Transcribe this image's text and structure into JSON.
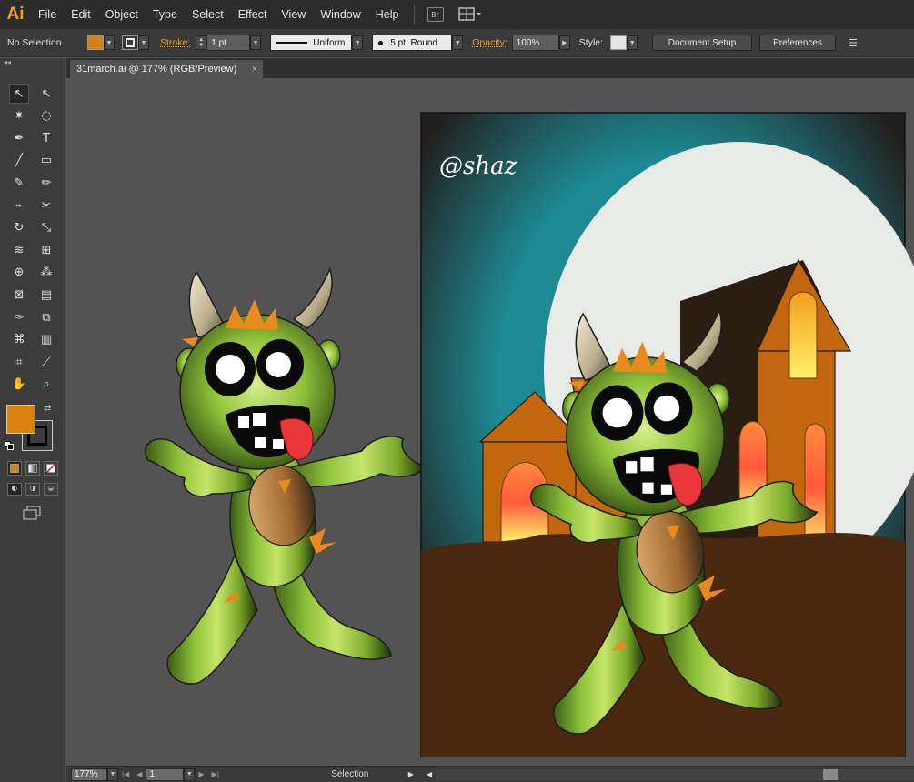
{
  "app": {
    "logo": "Ai",
    "menu": [
      "File",
      "Edit",
      "Object",
      "Type",
      "Select",
      "Effect",
      "View",
      "Window",
      "Help"
    ],
    "bridge_label": "Br"
  },
  "control_bar": {
    "selection_status": "No Selection",
    "fill_color": "#d7820f",
    "stroke_label": "Stroke:",
    "stroke_weight": "1 pt",
    "stroke_profile": "Uniform",
    "brush": "5 pt. Round",
    "opacity_label": "Opacity:",
    "opacity_value": "100%",
    "style_label": "Style:",
    "document_setup": "Document Setup",
    "preferences": "Preferences"
  },
  "document": {
    "tab_title": "31march.ai @ 177% (RGB/Preview)",
    "close_glyph": "×",
    "signature": "@shaz"
  },
  "toolbox": {
    "collapse_glyph": "◂◂",
    "fill_color": "#d7820f",
    "stroke_color": "#000000",
    "tools": [
      {
        "name": "selection-tool",
        "glyph": "↖",
        "active": true
      },
      {
        "name": "direct-selection-tool",
        "glyph": "↖"
      },
      {
        "name": "magic-wand-tool",
        "glyph": "✷"
      },
      {
        "name": "lasso-tool",
        "glyph": "◌"
      },
      {
        "name": "pen-tool",
        "glyph": "✒"
      },
      {
        "name": "type-tool",
        "glyph": "T"
      },
      {
        "name": "line-segment-tool",
        "glyph": "╱"
      },
      {
        "name": "rectangle-tool",
        "glyph": "▭"
      },
      {
        "name": "paintbrush-tool",
        "glyph": "✎"
      },
      {
        "name": "pencil-tool",
        "glyph": "✏"
      },
      {
        "name": "blob-brush-tool",
        "glyph": "⌁"
      },
      {
        "name": "scissors-tool",
        "glyph": "✂"
      },
      {
        "name": "rotate-tool",
        "glyph": "↻"
      },
      {
        "name": "scale-tool",
        "glyph": "⤡"
      },
      {
        "name": "warp-tool",
        "glyph": "≋"
      },
      {
        "name": "free-transform-tool",
        "glyph": "⊞"
      },
      {
        "name": "shape-builder-tool",
        "glyph": "⊕"
      },
      {
        "name": "symbol-sprayer-tool",
        "glyph": "⁂"
      },
      {
        "name": "mesh-tool",
        "glyph": "⊠"
      },
      {
        "name": "gradient-tool",
        "glyph": "▤"
      },
      {
        "name": "eyedropper-tool",
        "glyph": "✑"
      },
      {
        "name": "blend-tool",
        "glyph": "⧉"
      },
      {
        "name": "symbol-tool",
        "glyph": "⌘"
      },
      {
        "name": "column-graph-tool",
        "glyph": "▥"
      },
      {
        "name": "artboard-tool",
        "glyph": "⌗"
      },
      {
        "name": "slice-tool",
        "glyph": "⟋"
      },
      {
        "name": "hand-tool",
        "glyph": "✋"
      },
      {
        "name": "zoom-tool",
        "glyph": "⌕"
      }
    ]
  },
  "status_bar": {
    "zoom": "177%",
    "artboard_number": "1",
    "current_tool": "Selection"
  }
}
